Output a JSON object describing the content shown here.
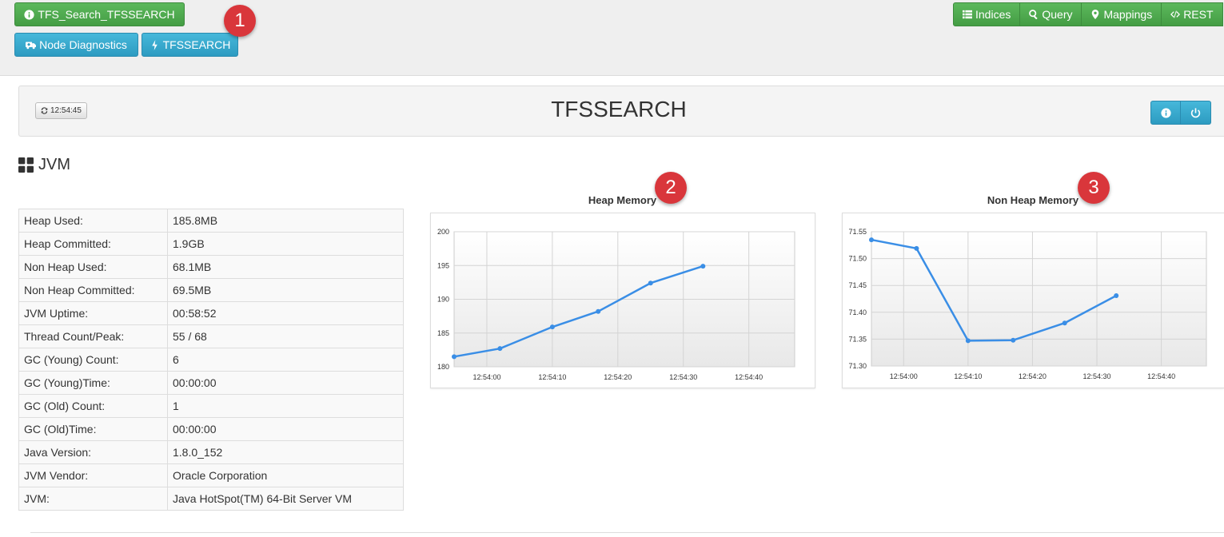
{
  "topbar": {
    "cluster_button": "TFS_Search_TFSSEARCH",
    "node_diag_button": "Node Diagnostics",
    "node_button": "TFSSEARCH",
    "nav": [
      {
        "label": "Indices",
        "icon": "list-icon"
      },
      {
        "label": "Query",
        "icon": "search-icon"
      },
      {
        "label": "Mappings",
        "icon": "map-marker-icon"
      },
      {
        "label": "REST",
        "icon": "code-icon"
      }
    ]
  },
  "markers": [
    "1",
    "2",
    "3"
  ],
  "panel": {
    "refresh_time": "12:54:45",
    "title": "TFSSEARCH"
  },
  "section": {
    "title": "JVM"
  },
  "jvm_table": [
    {
      "key": "Heap Used:",
      "value": "185.8MB"
    },
    {
      "key": "Heap Committed:",
      "value": "1.9GB"
    },
    {
      "key": "Non Heap Used:",
      "value": "68.1MB"
    },
    {
      "key": "Non Heap Committed:",
      "value": "69.5MB"
    },
    {
      "key": "JVM Uptime:",
      "value": "00:58:52"
    },
    {
      "key": "Thread Count/Peak:",
      "value": "55 / 68"
    },
    {
      "key": "GC (Young) Count:",
      "value": "6"
    },
    {
      "key": "GC (Young)Time:",
      "value": "00:00:00"
    },
    {
      "key": "GC (Old) Count:",
      "value": "1"
    },
    {
      "key": "GC (Old)Time:",
      "value": "00:00:00"
    },
    {
      "key": "Java Version:",
      "value": "1.8.0_152"
    },
    {
      "key": "JVM Vendor:",
      "value": "Oracle Corporation"
    },
    {
      "key": "JVM:",
      "value": "Java HotSpot(TM) 64-Bit Server VM"
    }
  ],
  "colors": {
    "series": "#3a8ee6",
    "marker": "#d9363b",
    "button_green": "#5cb85c",
    "button_blue": "#46b8da"
  },
  "chart_data": [
    {
      "type": "line",
      "title": "Heap Memory",
      "xlabel": "",
      "ylabel": "",
      "x": [
        "12:53:55",
        "12:54:02",
        "12:54:10",
        "12:54:17",
        "12:54:25",
        "12:54:33"
      ],
      "x_ticks": [
        "12:54:00",
        "12:54:10",
        "12:54:20",
        "12:54:30",
        "12:54:40"
      ],
      "values": [
        181.5,
        182.7,
        185.9,
        188.2,
        192.4,
        194.9
      ],
      "ylim": [
        180,
        200
      ],
      "y_ticks": [
        "180",
        "185",
        "190",
        "195",
        "200"
      ],
      "grid": true
    },
    {
      "type": "line",
      "title": "Non Heap Memory",
      "xlabel": "",
      "ylabel": "",
      "x": [
        "12:53:55",
        "12:54:02",
        "12:54:10",
        "12:54:17",
        "12:54:25",
        "12:54:33"
      ],
      "x_ticks": [
        "12:54:00",
        "12:54:10",
        "12:54:20",
        "12:54:30",
        "12:54:40"
      ],
      "values": [
        71.535,
        71.519,
        71.347,
        71.348,
        71.38,
        71.431
      ],
      "ylim": [
        71.3,
        71.55
      ],
      "y_ticks": [
        "71.30",
        "71.35",
        "71.40",
        "71.45",
        "71.50",
        "71.55"
      ],
      "grid": true
    }
  ]
}
